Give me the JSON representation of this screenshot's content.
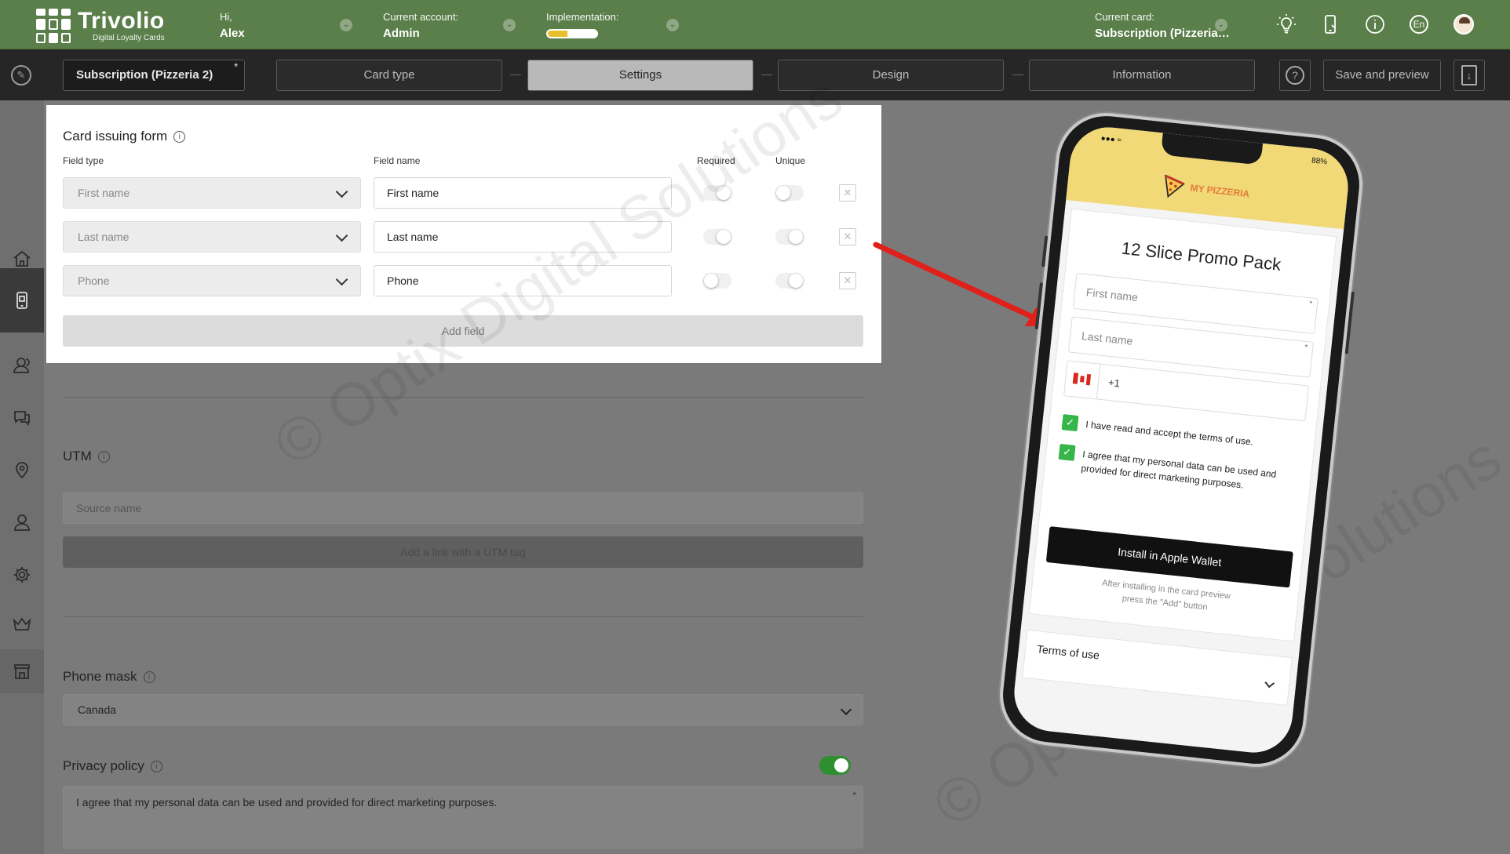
{
  "brand": {
    "name": "Trivolio",
    "tagline": "Digital Loyalty Cards"
  },
  "topbar": {
    "greeting_label": "Hi,",
    "user_name": "Alex",
    "account_label": "Current account:",
    "account_value": "Admin",
    "implementation_label": "Implementation:",
    "implementation_progress": 0.4,
    "current_card_label": "Current card:",
    "current_card_value": "Subscription (Pizzeria…",
    "lang": "En",
    "icons": [
      "lightbulb-icon",
      "phone-icon",
      "info-icon",
      "language-icon",
      "avatar"
    ],
    "accent_color": "#5b7f4a"
  },
  "toolbar": {
    "card_name": "Subscription (Pizzeria 2)",
    "card_name_marker": "*",
    "steps": [
      {
        "label": "Card type",
        "active": false
      },
      {
        "label": "Settings",
        "active": true
      },
      {
        "label": "Design",
        "active": false
      },
      {
        "label": "Information",
        "active": false
      }
    ],
    "help": "?",
    "save_label": "Save and preview"
  },
  "sidebar": {
    "items": [
      "home-icon",
      "mobile-card-icon",
      "clients-icon",
      "chat-icon",
      "location-icon",
      "user-icon",
      "settings-icon",
      "crown-icon",
      "store-icon"
    ],
    "active": "mobile-card-icon"
  },
  "form": {
    "title": "Card issuing form",
    "col_field_type": "Field type",
    "col_field_name": "Field name",
    "col_required": "Required",
    "col_unique": "Unique",
    "rows": [
      {
        "type": "First name",
        "name": "First name",
        "required": false,
        "unique": false
      },
      {
        "type": "Last name",
        "name": "Last name",
        "required": false,
        "unique": false
      },
      {
        "type": "Phone",
        "name": "Phone",
        "required": false,
        "unique": false
      }
    ],
    "add_field": "Add field"
  },
  "utm": {
    "title": "UTM",
    "source_placeholder": "Source name",
    "add_link": "Add a link with a UTM tag"
  },
  "phone_mask": {
    "title": "Phone mask",
    "value": "Canada"
  },
  "privacy": {
    "title": "Privacy policy",
    "enabled": true,
    "text": "I agree that my personal data can be used and provided for direct marketing purposes.",
    "marker": "*"
  },
  "watermark": "© Optix Digital Solutions",
  "preview": {
    "status_battery": "88%",
    "brand": "MY PIZZERIA",
    "title": "12 Slice Promo Pack",
    "first_name": "First name",
    "last_name": "Last name",
    "phone_code": "+1",
    "required_marker": "*",
    "terms_check": "I have read and accept the terms of use.",
    "marketing_check": "I agree that my personal data can be used and provided for direct marketing purposes.",
    "wallet_button": "Install in Apple Wallet",
    "note_line1": "After installing in the card preview",
    "note_line2": "press the \"Add\" button",
    "terms_label": "Terms of use"
  }
}
